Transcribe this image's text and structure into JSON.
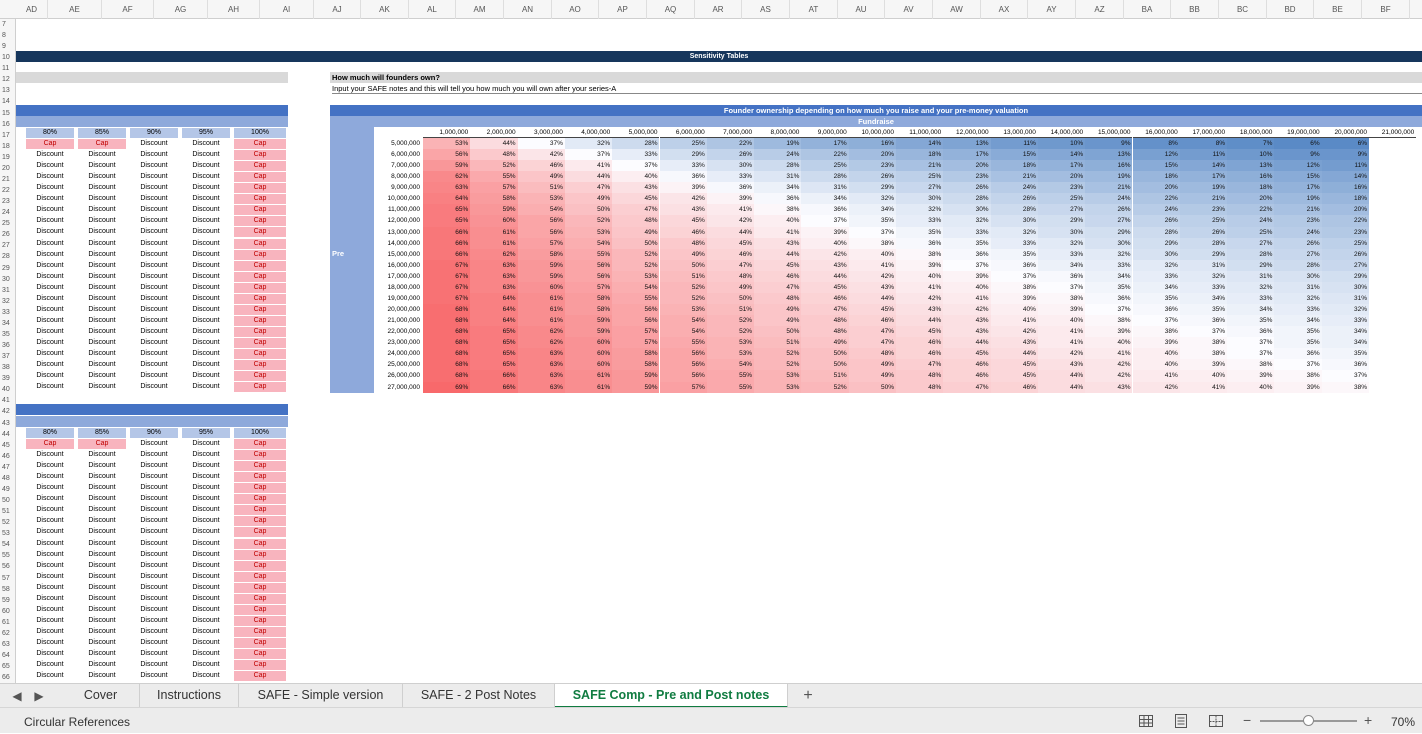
{
  "columns": [
    "AD",
    "AE",
    "AF",
    "AG",
    "AH",
    "AI",
    "AJ",
    "AK",
    "AL",
    "AM",
    "AN",
    "AO",
    "AP",
    "AQ",
    "AR",
    "AS",
    "AT",
    "AU",
    "AV",
    "AW",
    "AX",
    "AY",
    "AZ",
    "BA",
    "BB",
    "BC",
    "BD",
    "BE",
    "BF"
  ],
  "rows": [
    "7",
    "8",
    "9",
    "10",
    "11",
    "12",
    "13",
    "14",
    "15",
    "16",
    "17",
    "18",
    "19",
    "20",
    "21",
    "22",
    "23",
    "24",
    "25",
    "26",
    "27",
    "28",
    "29",
    "30",
    "31",
    "32",
    "33",
    "34",
    "35",
    "36",
    "37",
    "38",
    "39",
    "40",
    "41",
    "42",
    "43",
    "44",
    "45",
    "46",
    "47",
    "48",
    "49",
    "50",
    "51",
    "52",
    "53",
    "54",
    "55",
    "56",
    "57",
    "58",
    "59",
    "60",
    "61",
    "62",
    "63",
    "64",
    "65",
    "66"
  ],
  "banner": {
    "title": "Sensitivity Tables"
  },
  "intro": {
    "question": "How much will founders own?",
    "description": "Input your SAFE notes and this will tell you how much you will own after your series-A"
  },
  "left_table_1": {
    "headers": [
      "80%",
      "85%",
      "90%",
      "95%",
      "100%"
    ],
    "cap_row": [
      "Cap",
      "Cap",
      "Discount",
      "Discount",
      "Cap"
    ],
    "row_values": [
      "Discount",
      "Discount",
      "Discount",
      "Discount",
      "Cap"
    ],
    "row_count": 22
  },
  "left_table_2": {
    "headers": [
      "80%",
      "85%",
      "90%",
      "95%",
      "100%"
    ],
    "cap_row": [
      "Cap",
      "Cap",
      "Discount",
      "Discount",
      "Cap"
    ],
    "row_values": [
      "Discount",
      "Discount",
      "Discount",
      "Discount",
      "Cap"
    ],
    "row_count": 21
  },
  "heatmap": {
    "title": "Founder ownership depending on how much you raise and your pre-money valuation",
    "fundraise_label": "Fundraise",
    "pre_label": "Pre",
    "x_labels": [
      "1,000,000",
      "2,000,000",
      "3,000,000",
      "4,000,000",
      "5,000,000",
      "6,000,000",
      "7,000,000",
      "8,000,000",
      "9,000,000",
      "10,000,000",
      "11,000,000",
      "12,000,000",
      "13,000,000",
      "14,000,000",
      "15,000,000",
      "16,000,000",
      "17,000,000",
      "18,000,000",
      "19,000,000",
      "20,000,000",
      "21,000,000"
    ],
    "y_labels": [
      "5,000,000",
      "6,000,000",
      "7,000,000",
      "8,000,000",
      "9,000,000",
      "10,000,000",
      "11,000,000",
      "12,000,000",
      "13,000,000",
      "14,000,000",
      "15,000,000",
      "16,000,000",
      "17,000,000",
      "18,000,000",
      "19,000,000",
      "20,000,000",
      "21,000,000",
      "22,000,000",
      "23,000,000",
      "24,000,000",
      "25,000,000",
      "26,000,000",
      "27,000,000"
    ],
    "values": [
      [
        "53%",
        "44%",
        "37%",
        "32%",
        "28%",
        "25%",
        "22%",
        "19%",
        "17%",
        "16%",
        "14%",
        "13%",
        "11%",
        "10%",
        "9%",
        "8%",
        "8%",
        "7%",
        "6%",
        "6%",
        ""
      ],
      [
        "56%",
        "48%",
        "42%",
        "37%",
        "33%",
        "29%",
        "26%",
        "24%",
        "22%",
        "20%",
        "18%",
        "17%",
        "15%",
        "14%",
        "13%",
        "12%",
        "11%",
        "10%",
        "9%",
        "9%",
        ""
      ],
      [
        "59%",
        "52%",
        "46%",
        "41%",
        "37%",
        "33%",
        "30%",
        "28%",
        "25%",
        "23%",
        "21%",
        "20%",
        "18%",
        "17%",
        "16%",
        "15%",
        "14%",
        "13%",
        "12%",
        "11%",
        ""
      ],
      [
        "62%",
        "55%",
        "49%",
        "44%",
        "40%",
        "36%",
        "33%",
        "31%",
        "28%",
        "26%",
        "25%",
        "23%",
        "21%",
        "20%",
        "19%",
        "18%",
        "17%",
        "16%",
        "15%",
        "14%",
        ""
      ],
      [
        "63%",
        "57%",
        "51%",
        "47%",
        "43%",
        "39%",
        "36%",
        "34%",
        "31%",
        "29%",
        "27%",
        "26%",
        "24%",
        "23%",
        "21%",
        "20%",
        "19%",
        "18%",
        "17%",
        "16%",
        ""
      ],
      [
        "64%",
        "58%",
        "53%",
        "49%",
        "45%",
        "42%",
        "39%",
        "36%",
        "34%",
        "32%",
        "30%",
        "28%",
        "26%",
        "25%",
        "24%",
        "22%",
        "21%",
        "20%",
        "19%",
        "18%",
        ""
      ],
      [
        "65%",
        "59%",
        "54%",
        "50%",
        "47%",
        "43%",
        "41%",
        "38%",
        "36%",
        "34%",
        "32%",
        "30%",
        "28%",
        "27%",
        "26%",
        "24%",
        "23%",
        "22%",
        "21%",
        "20%",
        ""
      ],
      [
        "65%",
        "60%",
        "56%",
        "52%",
        "48%",
        "45%",
        "42%",
        "40%",
        "37%",
        "35%",
        "33%",
        "32%",
        "30%",
        "29%",
        "27%",
        "26%",
        "25%",
        "24%",
        "23%",
        "22%",
        ""
      ],
      [
        "66%",
        "61%",
        "56%",
        "53%",
        "49%",
        "46%",
        "44%",
        "41%",
        "39%",
        "37%",
        "35%",
        "33%",
        "32%",
        "30%",
        "29%",
        "28%",
        "26%",
        "25%",
        "24%",
        "23%",
        ""
      ],
      [
        "66%",
        "61%",
        "57%",
        "54%",
        "50%",
        "48%",
        "45%",
        "43%",
        "40%",
        "38%",
        "36%",
        "35%",
        "33%",
        "32%",
        "30%",
        "29%",
        "28%",
        "27%",
        "26%",
        "25%",
        ""
      ],
      [
        "66%",
        "62%",
        "58%",
        "55%",
        "52%",
        "49%",
        "46%",
        "44%",
        "42%",
        "40%",
        "38%",
        "36%",
        "35%",
        "33%",
        "32%",
        "30%",
        "29%",
        "28%",
        "27%",
        "26%",
        ""
      ],
      [
        "67%",
        "63%",
        "59%",
        "56%",
        "52%",
        "50%",
        "47%",
        "45%",
        "43%",
        "41%",
        "39%",
        "37%",
        "36%",
        "34%",
        "33%",
        "32%",
        "31%",
        "29%",
        "28%",
        "27%",
        ""
      ],
      [
        "67%",
        "63%",
        "59%",
        "56%",
        "53%",
        "51%",
        "48%",
        "46%",
        "44%",
        "42%",
        "40%",
        "39%",
        "37%",
        "36%",
        "34%",
        "33%",
        "32%",
        "31%",
        "30%",
        "29%",
        ""
      ],
      [
        "67%",
        "63%",
        "60%",
        "57%",
        "54%",
        "52%",
        "49%",
        "47%",
        "45%",
        "43%",
        "41%",
        "40%",
        "38%",
        "37%",
        "35%",
        "34%",
        "33%",
        "32%",
        "31%",
        "30%",
        ""
      ],
      [
        "67%",
        "64%",
        "61%",
        "58%",
        "55%",
        "52%",
        "50%",
        "48%",
        "46%",
        "44%",
        "42%",
        "41%",
        "39%",
        "38%",
        "36%",
        "35%",
        "34%",
        "33%",
        "32%",
        "31%",
        ""
      ],
      [
        "68%",
        "64%",
        "61%",
        "58%",
        "56%",
        "53%",
        "51%",
        "49%",
        "47%",
        "45%",
        "43%",
        "42%",
        "40%",
        "39%",
        "37%",
        "36%",
        "35%",
        "34%",
        "33%",
        "32%",
        ""
      ],
      [
        "68%",
        "64%",
        "61%",
        "59%",
        "56%",
        "54%",
        "52%",
        "49%",
        "48%",
        "46%",
        "44%",
        "43%",
        "41%",
        "40%",
        "38%",
        "37%",
        "36%",
        "35%",
        "34%",
        "33%",
        ""
      ],
      [
        "68%",
        "65%",
        "62%",
        "59%",
        "57%",
        "54%",
        "52%",
        "50%",
        "48%",
        "47%",
        "45%",
        "43%",
        "42%",
        "41%",
        "39%",
        "38%",
        "37%",
        "36%",
        "35%",
        "34%",
        ""
      ],
      [
        "68%",
        "65%",
        "62%",
        "60%",
        "57%",
        "55%",
        "53%",
        "51%",
        "49%",
        "47%",
        "46%",
        "44%",
        "43%",
        "41%",
        "40%",
        "39%",
        "38%",
        "37%",
        "35%",
        "34%",
        ""
      ],
      [
        "68%",
        "65%",
        "63%",
        "60%",
        "58%",
        "56%",
        "53%",
        "52%",
        "50%",
        "48%",
        "46%",
        "45%",
        "44%",
        "42%",
        "41%",
        "40%",
        "38%",
        "37%",
        "36%",
        "35%",
        ""
      ],
      [
        "68%",
        "65%",
        "63%",
        "60%",
        "58%",
        "56%",
        "54%",
        "52%",
        "50%",
        "49%",
        "47%",
        "46%",
        "45%",
        "43%",
        "42%",
        "40%",
        "39%",
        "38%",
        "37%",
        "36%",
        ""
      ],
      [
        "68%",
        "66%",
        "63%",
        "61%",
        "59%",
        "56%",
        "55%",
        "53%",
        "51%",
        "49%",
        "48%",
        "46%",
        "45%",
        "44%",
        "42%",
        "41%",
        "40%",
        "39%",
        "38%",
        "37%",
        ""
      ],
      [
        "69%",
        "66%",
        "63%",
        "61%",
        "59%",
        "57%",
        "55%",
        "53%",
        "52%",
        "50%",
        "48%",
        "47%",
        "46%",
        "44%",
        "43%",
        "42%",
        "41%",
        "40%",
        "39%",
        "38%",
        ""
      ]
    ],
    "colors": {
      "high": "#f8696b",
      "mid": "#fcfcff",
      "low": "#5a8ac6"
    }
  },
  "sheet_tabs": [
    {
      "label": "Cover"
    },
    {
      "label": "Instructions"
    },
    {
      "label": "SAFE - Simple version"
    },
    {
      "label": "SAFE - 2 Post Notes"
    },
    {
      "label": "SAFE Comp - Pre and Post notes"
    }
  ],
  "active_tab": "SAFE Comp - Pre and Post notes",
  "add_sheet_label": "+",
  "nav": {
    "prev": "◀",
    "next": "▶"
  },
  "status": {
    "left_text": "Circular References",
    "zoom_minus": "−",
    "zoom_plus": "+",
    "zoom_level": "70%",
    "zoom_fraction": 0.5
  },
  "theme": {
    "navy": "#16365c",
    "blue": "#4472c4",
    "lightblue": "#b4c6e7",
    "capfill": "#f8b4be",
    "capcolor": "#c00000",
    "active_tab": "#107c41"
  }
}
